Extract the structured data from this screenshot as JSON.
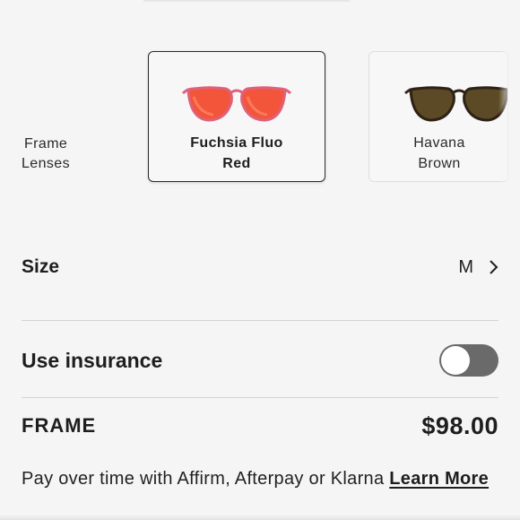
{
  "color_picker": {
    "row_label_line1": "Frame",
    "row_label_line2": "Lenses",
    "options": [
      {
        "name_line1": "Fuchsia Fluo",
        "name_line2": "Red",
        "selected": true,
        "frame_color": "#e0607a",
        "lens_color": "#f2553a"
      },
      {
        "name_line1": "Havana",
        "name_line2": "Brown",
        "selected": false,
        "frame_color": "#3a2a1a",
        "lens_color": "#5b4a25"
      }
    ]
  },
  "size": {
    "label": "Size",
    "value": "M"
  },
  "insurance": {
    "label": "Use insurance",
    "enabled": false
  },
  "summary": {
    "frame_label": "FRAME",
    "frame_price": "$98.00"
  },
  "financing": {
    "text": "Pay over time with Affirm, Afterpay or Klarna ",
    "link_label": "Learn More"
  },
  "colors": {
    "background": "#f5f5f5",
    "text": "#1e1e1e",
    "toggle_off": "#6a6a6a",
    "divider": "#d3d3d3"
  }
}
